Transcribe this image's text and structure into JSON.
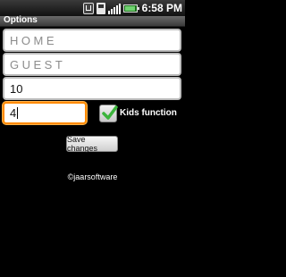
{
  "status_bar": {
    "time": "6:58 PM",
    "icons": [
      "usb-icon",
      "sd-card-icon",
      "signal-icon",
      "battery-icon"
    ]
  },
  "window": {
    "title": "Options"
  },
  "fields": {
    "home_value": "HOME",
    "guest_value": "GUEST",
    "number_value": "10",
    "kids_value": "4"
  },
  "kids_function": {
    "label": "Kids function",
    "checked": true
  },
  "actions": {
    "save_label": "Save changes"
  },
  "footer": {
    "copyright": "©jaarsoftware"
  },
  "colors": {
    "focus": "#ff8a00",
    "check": "#3cb43c"
  }
}
